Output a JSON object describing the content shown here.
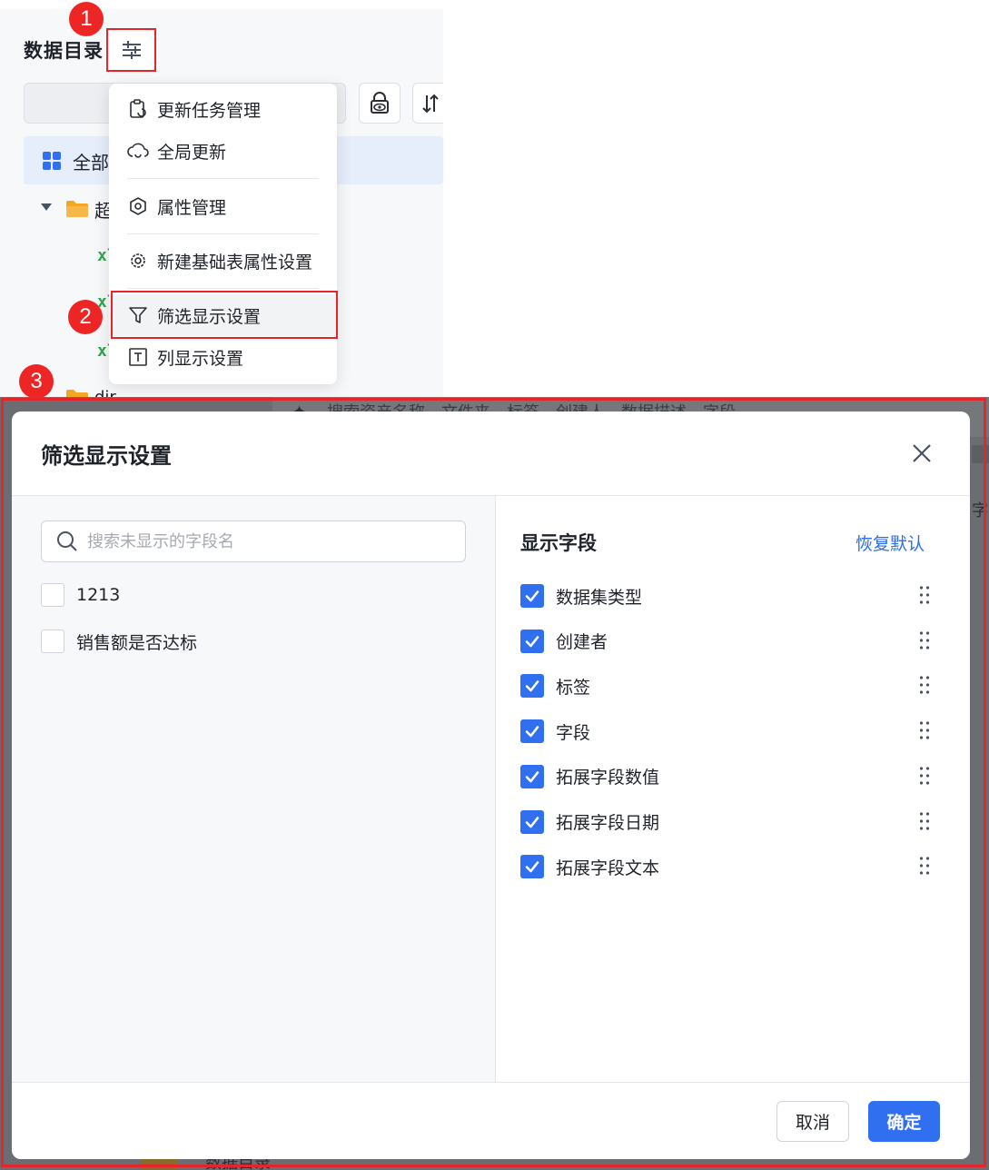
{
  "sidebar": {
    "title": "数据目录",
    "tree": {
      "all_label": "全部",
      "folder_label": "超",
      "file_icon_text": "xl",
      "folder2_label": "dir"
    }
  },
  "menu": {
    "items": [
      {
        "label": "更新任务管理",
        "icon": "task-refresh-icon"
      },
      {
        "label": "全局更新",
        "icon": "cloud-refresh-icon"
      },
      {
        "label": "属性管理",
        "icon": "hexagon-settings-icon"
      },
      {
        "label": "新建基础表属性设置",
        "icon": "gear-icon"
      },
      {
        "label": "筛选显示设置",
        "icon": "filter-icon"
      },
      {
        "label": "列显示设置",
        "icon": "column-icon"
      }
    ]
  },
  "badges": [
    "1",
    "2",
    "3"
  ],
  "background_ghost": {
    "search_hint": "搜索资产名称、文件夹、标签、创建人、数据描述、字段",
    "right_char": "字",
    "bottom_text": "数据目录"
  },
  "modal": {
    "title": "筛选显示设置",
    "search": {
      "placeholder": "搜索未显示的字段名",
      "value": ""
    },
    "hidden_fields": [
      "1213",
      "销售额是否达标"
    ],
    "shown_title": "显示字段",
    "reset_label": "恢复默认",
    "shown_fields": [
      "数据集类型",
      "创建者",
      "标签",
      "字段",
      "拓展字段数值",
      "拓展字段日期",
      "拓展字段文本"
    ],
    "cancel_label": "取消",
    "ok_label": "确定"
  },
  "colors": {
    "accent": "#2f6ff0",
    "highlight_red": "#e5252a",
    "badge_red": "#ee2525",
    "link_blue": "#2c6dea"
  }
}
